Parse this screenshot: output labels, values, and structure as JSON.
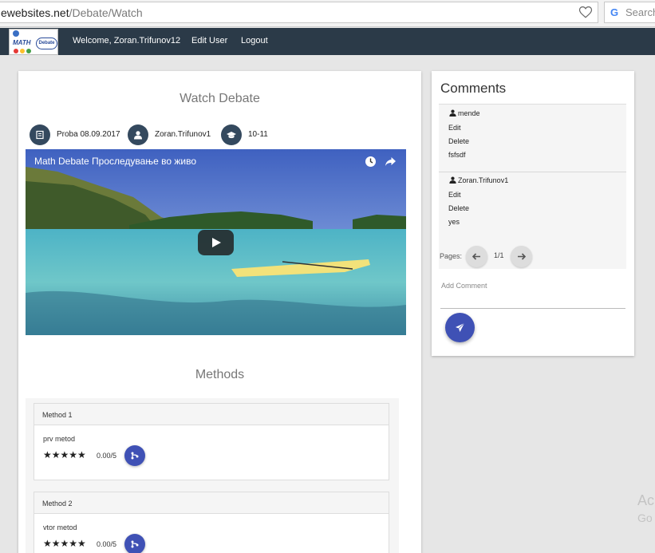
{
  "browser": {
    "url_domain": "ewebsites.net",
    "url_path": "/Debate/Watch",
    "search_placeholder": "Search",
    "search_logo": "G"
  },
  "navbar": {
    "logo_math": "MATH",
    "logo_bubble": "Debate",
    "welcome": "Welcome, Zoran.Trifunov12",
    "edit_user": "Edit User",
    "logout": "Logout"
  },
  "watch": {
    "title": "Watch Debate",
    "meta": {
      "debate_name": "Proba 08.09.2017",
      "author": "Zoran.Trifunov1",
      "grade": "10-11"
    },
    "video_title": "Math Debate Проследување во живо"
  },
  "methods": {
    "title": "Methods",
    "items": [
      {
        "name": "Method 1",
        "description": "prv metod",
        "stars": "★★★★★",
        "rating": "0.00/5"
      },
      {
        "name": "Method 2",
        "description": "vtor metod",
        "stars": "★★★★★",
        "rating": "0.00/5"
      }
    ]
  },
  "comments": {
    "title": "Comments",
    "items": [
      {
        "author": "mende",
        "edit": "Edit",
        "delete": "Delete",
        "text": "fsfsdf"
      },
      {
        "author": "Zoran.Trifunov1",
        "edit": "Edit",
        "delete": "Delete",
        "text": "yes"
      }
    ],
    "pages_label": "Pages:",
    "page_indicator": "1/1",
    "add_comment_placeholder": "Add Comment"
  },
  "watermark": {
    "line1": "Ac",
    "line2": "Go"
  },
  "colors": {
    "navbar": "#2b3a48",
    "accent": "#3f51b5",
    "meta_icon_bg": "#34495e"
  }
}
